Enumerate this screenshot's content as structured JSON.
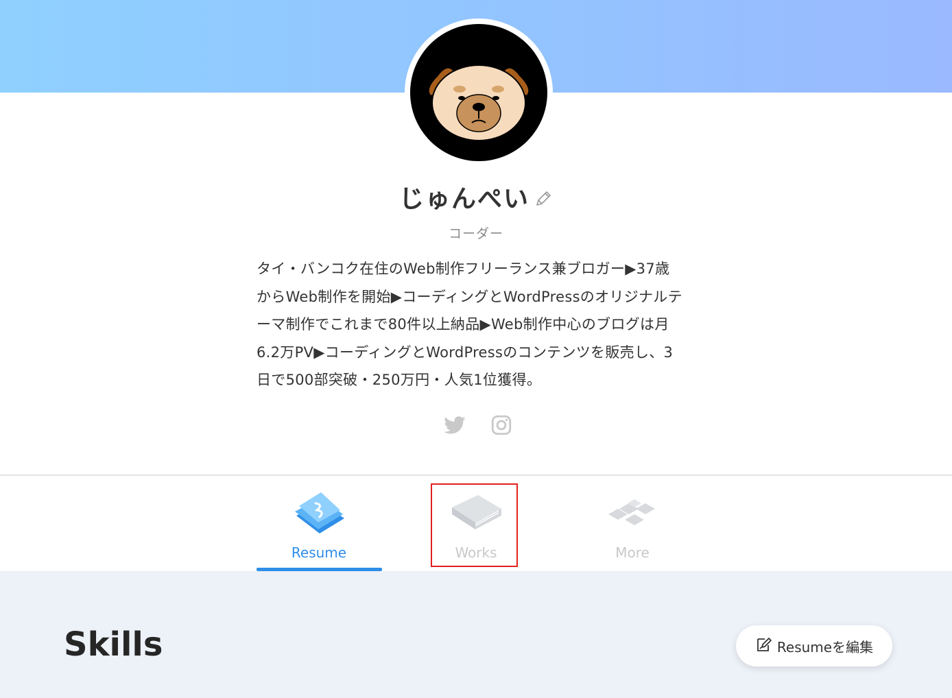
{
  "profile": {
    "name": "じゅんぺい",
    "role": "コーダー",
    "bio_lines": [
      "タイ・バンコク在住のWeb制作フリーランス兼ブロガー▶37歳",
      "からWeb制作を開始▶コーディングとWordPressのオリジナルテ",
      "ーマ制作でこれまで80件以上納品▶Web制作中心のブログは月",
      "6.2万PV▶コーディングとWordPressのコンテンツを販売し、3",
      "日で500部突破・250万円・人気1位獲得。"
    ]
  },
  "social": {
    "icons": [
      "twitter-icon",
      "instagram-icon"
    ]
  },
  "tabs": [
    {
      "label": "Resume",
      "icon": "resume-icon",
      "active": true
    },
    {
      "label": "Works",
      "icon": "works-book-icon",
      "active": false
    },
    {
      "label": "More",
      "icon": "more-tiles-icon",
      "active": false
    }
  ],
  "section": {
    "title": "Skills",
    "edit_button_label": "Resumeを編集"
  },
  "colors": {
    "accent": "#2f8ee8",
    "cover_start": "#8fd0ff",
    "cover_end": "#9ab9ff",
    "content_bg": "#edf1f8",
    "highlight": "#e0201f"
  }
}
